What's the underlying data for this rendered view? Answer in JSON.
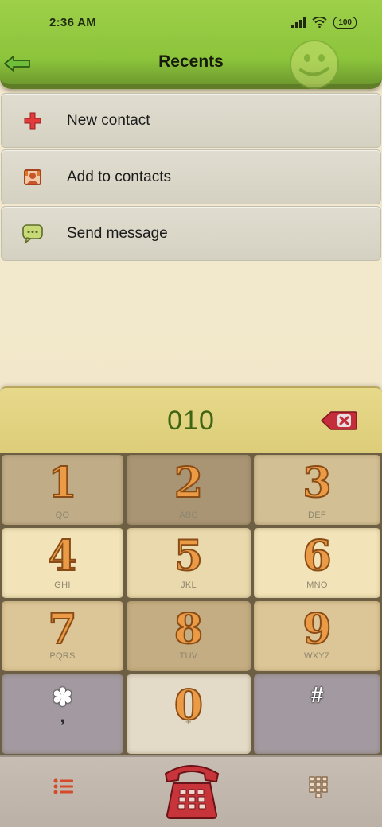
{
  "status_bar": {
    "time": "2:36 AM",
    "battery": "100"
  },
  "header": {
    "title": "Recents"
  },
  "menu": {
    "items": [
      {
        "label": "New contact",
        "icon": "plus-icon"
      },
      {
        "label": "Add to contacts",
        "icon": "contact-card-icon"
      },
      {
        "label": "Send message",
        "icon": "message-bubble-icon"
      }
    ]
  },
  "dialer": {
    "number": "010"
  },
  "keypad": {
    "keys": [
      {
        "digit": "1",
        "letters": "QO"
      },
      {
        "digit": "2",
        "letters": "ABC"
      },
      {
        "digit": "3",
        "letters": "DEF"
      },
      {
        "digit": "4",
        "letters": "GHI"
      },
      {
        "digit": "5",
        "letters": "JKL"
      },
      {
        "digit": "6",
        "letters": "MNO"
      },
      {
        "digit": "7",
        "letters": "PQRS"
      },
      {
        "digit": "8",
        "letters": "TUV"
      },
      {
        "digit": "9",
        "letters": "WXYZ"
      },
      {
        "symbol": "✽",
        "letters": ","
      },
      {
        "digit": "0",
        "letters": "+"
      },
      {
        "symbol": "#",
        "letters": ""
      }
    ]
  },
  "colors": {
    "header_green": "#8cc43c",
    "digit_orange": "#eb9a46",
    "dial_number_green": "#3f6512",
    "phone_red": "#c7353a"
  }
}
